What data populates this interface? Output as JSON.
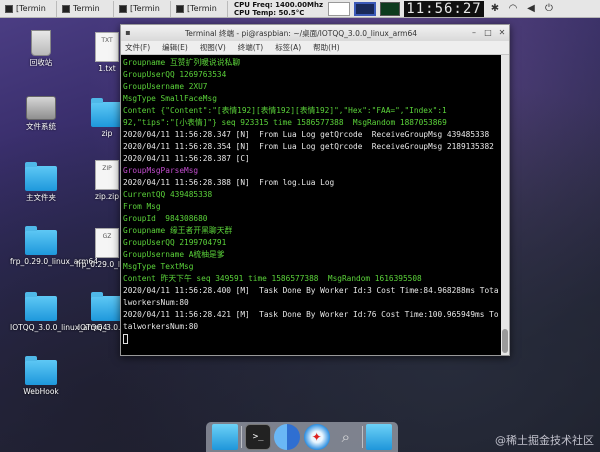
{
  "taskbar": {
    "tasks": [
      {
        "label": "[Termin"
      },
      {
        "label": "Termin"
      },
      {
        "label": "[Termin"
      },
      {
        "label": "[Termin"
      }
    ],
    "cpu_freq": "CPU Freq: 1400.00Mhz",
    "cpu_temp": "CPU Temp: 50.5°C",
    "clock": "11:56:27"
  },
  "desktop": {
    "icons": [
      {
        "label": "回收站",
        "kind": "trash"
      },
      {
        "label": "1.txt",
        "kind": "file",
        "tag": "TXT"
      },
      {
        "label": "文件系统",
        "kind": "hdd"
      },
      {
        "label": "zip",
        "kind": "folder"
      },
      {
        "label": "主文件夹",
        "kind": "folder"
      },
      {
        "label": "zip.zip",
        "kind": "file",
        "tag": "ZIP"
      },
      {
        "label": "frp_0.29.0_linux_arm64",
        "kind": "folder"
      },
      {
        "label": "frp_0.29.0_linux_arm64...",
        "kind": "file",
        "tag": "GZ"
      },
      {
        "label": "IOTQQ_3.0.0_linux_arm64",
        "kind": "folder"
      },
      {
        "label": "IOTQQ_3.0.0_...",
        "kind": "folder"
      },
      {
        "label": "WebHook",
        "kind": "folder"
      }
    ]
  },
  "terminal": {
    "title": "Terminal 终端 - pi@raspbian: ~/桌面/IOTQQ_3.0.0_linux_arm64",
    "menu": [
      "文件(F)",
      "编辑(E)",
      "视图(V)",
      "终端(T)",
      "标签(A)",
      "帮助(H)"
    ],
    "lines": [
      {
        "text": "Groupname 互赞扩列暖说说私聊",
        "color": "g"
      },
      {
        "text": "GroupUserQQ 1269763534",
        "color": "g"
      },
      {
        "text": "GroupUsername 2XU7",
        "color": "g"
      },
      {
        "text": "MsgType SmallFaceMsg",
        "color": "g"
      },
      {
        "text": "Content {\"Content\":\"[表情192][表情192][表情192]\",\"Hex\":\"FAA=\",\"Index\":1",
        "color": "g"
      },
      {
        "text": "92,\"tips\":\"[小表情]\"} seq 923315 time 1586577388  MsgRandom 1887053869",
        "color": "g"
      },
      {
        "text": "2020/04/11 11:56:28.347 [N]  From Lua Log getQrcode  ReceiveGroupMsg 439485338",
        "color": "w"
      },
      {
        "text": "2020/04/11 11:56:28.354 [N]  From Lua Log getQrcode  ReceiveGroupMsg 2189135382",
        "color": "w"
      },
      {
        "text": "2020/04/11 11:56:28.387 [C]",
        "color": "w"
      },
      {
        "text": "GroupMsgParseMsg",
        "color": "m"
      },
      {
        "text": "2020/04/11 11:56:28.388 [N]  From log.Lua Log",
        "color": "w"
      },
      {
        "text": "CurrentQQ 439485338",
        "color": "g"
      },
      {
        "text": "From Msg",
        "color": "g"
      },
      {
        "text": "GroupId  984308680",
        "color": "g"
      },
      {
        "text": "Groupname 缘王者开黑聊天群",
        "color": "g"
      },
      {
        "text": "GroupUserQQ 2199704791",
        "color": "g"
      },
      {
        "text": "GroupUsername A梳柚是爹",
        "color": "g"
      },
      {
        "text": "MsgType TextMsg",
        "color": "g"
      },
      {
        "text": "Content 昨天下午 seq 349591 time 1586577388  MsgRandom 1616395508",
        "color": "g"
      },
      {
        "text": "2020/04/11 11:56:28.400 [M]  Task Done By Worker Id:3 Cost Time:84.968288ms Tota",
        "color": "w"
      },
      {
        "text": "lworkersNum:80",
        "color": "w"
      },
      {
        "text": "2020/04/11 11:56:28.421 [M]  Task Done By Worker Id:76 Cost Time:100.965949ms To",
        "color": "w"
      },
      {
        "text": "talworkersNum:80",
        "color": "w"
      }
    ]
  },
  "dock": {
    "items": [
      "folder-icon",
      "terminal-icon",
      "finder-icon",
      "safari-icon",
      "search-icon",
      "folder-icon"
    ]
  },
  "watermark": "@稀土掘金技术社区"
}
